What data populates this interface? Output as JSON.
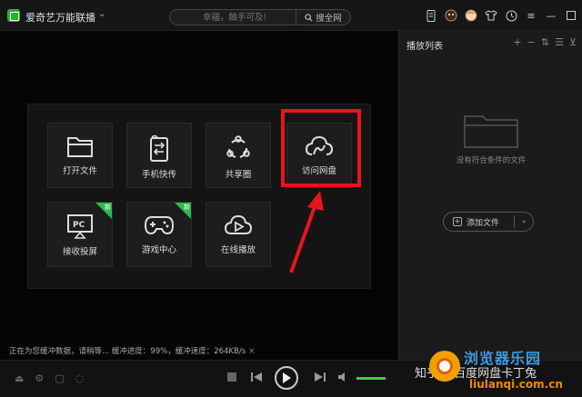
{
  "titlebar": {
    "app_title": "爱奇艺万能联播",
    "search_placeholder": "幸福，触手可及!",
    "search_button": "搜全网"
  },
  "tiles": [
    {
      "label": "打开文件",
      "icon": "folder-icon"
    },
    {
      "label": "手机快传",
      "icon": "phone-transfer-icon"
    },
    {
      "label": "共享圈",
      "icon": "share-circle-icon"
    },
    {
      "label": "访问网盘",
      "icon": "cloud-icon"
    },
    {
      "label": "接收投屏",
      "icon": "pc-cast-icon",
      "badge": "新"
    },
    {
      "label": "游戏中心",
      "icon": "gamepad-icon",
      "badge": "新"
    },
    {
      "label": "在线播放",
      "icon": "online-play-icon"
    }
  ],
  "status": {
    "text": "正在为您缓冲数据，请稍等... 缓冲进度：99%，缓冲速度：264KB/s",
    "close": "×"
  },
  "sidebar": {
    "title": "播放列表",
    "empty_text": "没有符合条件的文件",
    "add_button": "添加文件"
  },
  "watermark": {
    "zhihu": "知乎 @百度网盘卡丁兔",
    "brand": "浏览器乐园",
    "url": "liulanqi.com.cn"
  },
  "colors": {
    "accent": "#1fb81f",
    "highlight": "#e8141c",
    "badge": "#2db84d"
  }
}
